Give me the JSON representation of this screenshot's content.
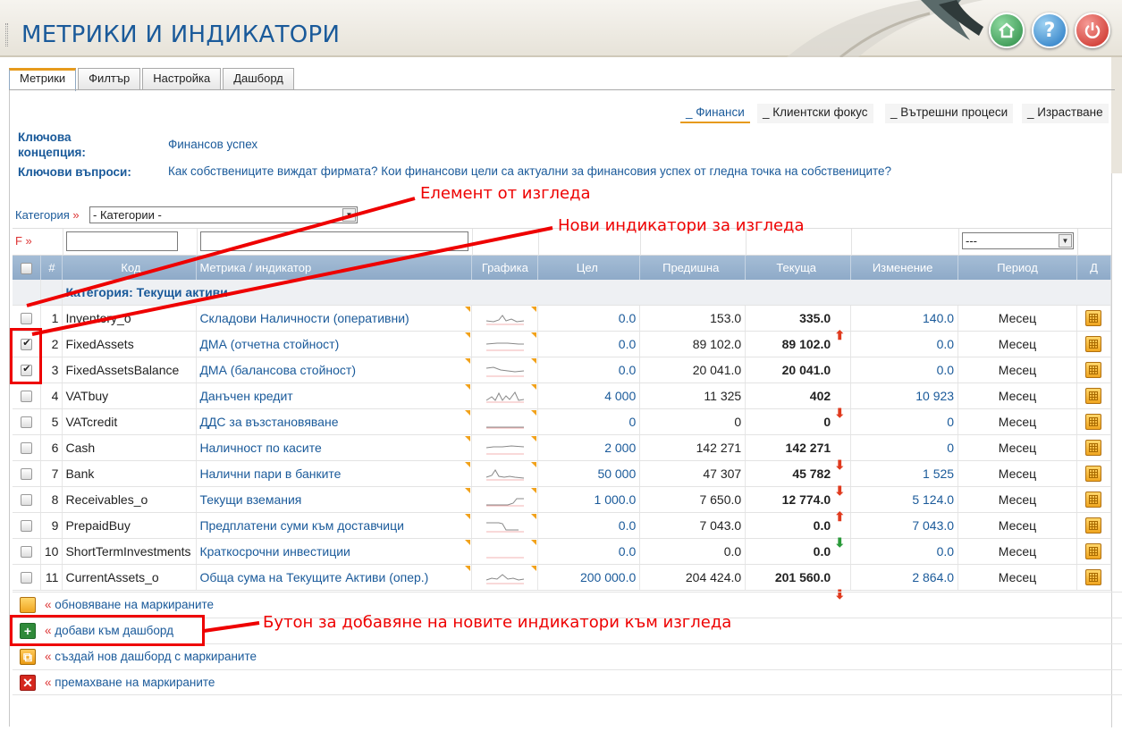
{
  "header": {
    "title": "МЕТРИКИ И ИНДИКАТОРИ",
    "buttons": {
      "home": "home-icon",
      "help": "?",
      "power": "power-icon"
    }
  },
  "tabs": [
    {
      "label": "Метрики",
      "active": true
    },
    {
      "label": "Филтър"
    },
    {
      "label": "Настройка"
    },
    {
      "label": "Дашборд"
    }
  ],
  "perspectives": [
    {
      "label": "_ Финанси",
      "active": true
    },
    {
      "label": "_ Клиентски фокус"
    },
    {
      "label": "_ Вътрешни процеси"
    },
    {
      "label": "_ Израстване"
    }
  ],
  "concept": {
    "label": "Ключова концепция:",
    "value": "Финансов успех",
    "questions_label": "Ключови въпроси:",
    "questions_value": "Как собствениците виждат фирмата? Кои финансови цели са актуални за финансовия успех от гледна точка на собствениците?"
  },
  "filter": {
    "category_label": "Категория",
    "category_marker": "»",
    "category_select": "- Категории -",
    "f_label": "F »",
    "period_select": "---"
  },
  "columns": {
    "num": "#",
    "code": "Код",
    "name": "Метрика / индикатор",
    "graph": "Графика",
    "target": "Цел",
    "previous": "Предишна",
    "current": "Текуща",
    "change": "Изменение",
    "period": "Период",
    "d": "Д"
  },
  "category_row": "Категория: Текущи активи",
  "rows": [
    {
      "n": "1",
      "code": "Inventory_o",
      "name": "Складови Наличности (оперативни)",
      "target": "0.0",
      "prev": "153.0",
      "cur": "335.0",
      "trend": "up",
      "chg": "140.0",
      "per": "Месец",
      "checked": false
    },
    {
      "n": "2",
      "code": "FixedAssets",
      "name": "ДМА (отчетна стойност)",
      "target": "0.0",
      "prev": "89 102.0",
      "cur": "89 102.0",
      "trend": "",
      "chg": "0.0",
      "per": "Месец",
      "checked": true
    },
    {
      "n": "3",
      "code": "FixedAssetsBalance",
      "name": "ДМА (балансова стойност)",
      "target": "0.0",
      "prev": "20 041.0",
      "cur": "20 041.0",
      "trend": "",
      "chg": "0.0",
      "per": "Месец",
      "checked": true
    },
    {
      "n": "4",
      "code": "VATbuy",
      "name": "Данъчен кредит",
      "target": "4 000",
      "prev": "11 325",
      "cur": "402",
      "trend": "down",
      "chg": "10 923",
      "per": "Месец",
      "checked": false
    },
    {
      "n": "5",
      "code": "VATcredit",
      "name": "ДДС за възстановяване",
      "target": "0",
      "prev": "0",
      "cur": "0",
      "trend": "",
      "chg": "0",
      "per": "Месец",
      "checked": false
    },
    {
      "n": "6",
      "code": "Cash",
      "name": "Наличност по касите",
      "target": "2 000",
      "prev": "142 271",
      "cur": "142 271",
      "trend": "down",
      "chg": "0",
      "per": "Месец",
      "checked": false
    },
    {
      "n": "7",
      "code": "Bank",
      "name": "Налични пари в банките",
      "target": "50 000",
      "prev": "47 307",
      "cur": "45 782",
      "trend": "down",
      "chg": "1 525",
      "per": "Месец",
      "checked": false
    },
    {
      "n": "8",
      "code": "Receivables_o",
      "name": "Текущи вземания",
      "target": "1 000.0",
      "prev": "7 650.0",
      "cur": "12 774.0",
      "trend": "up",
      "chg": "5 124.0",
      "per": "Месец",
      "checked": false
    },
    {
      "n": "9",
      "code": "PrepaidBuy",
      "name": "Предплатени суми към доставчици",
      "target": "0.0",
      "prev": "7 043.0",
      "cur": "0.0",
      "trend": "down-green",
      "chg": "7 043.0",
      "per": "Месец",
      "checked": false
    },
    {
      "n": "10",
      "code": "ShortTermInvestments",
      "name": "Краткосрочни инвестиции",
      "target": "0.0",
      "prev": "0.0",
      "cur": "0.0",
      "trend": "",
      "chg": "0.0",
      "per": "Месец",
      "checked": false
    },
    {
      "n": "11",
      "code": "CurrentAssets_o",
      "name": "Обща сума на Текущите Активи (опер.)",
      "target": "200 000.0",
      "prev": "204 424.0",
      "cur": "201 560.0",
      "trend": "down",
      "chg": "2 864.0",
      "per": "Месец",
      "checked": false
    }
  ],
  "actions": [
    {
      "marker": "«",
      "label": "обновяване на маркираните",
      "icon": "calculator-icon"
    },
    {
      "marker": "«",
      "label": "добави към дашборд",
      "icon": "plus-icon"
    },
    {
      "marker": "«",
      "label": "създай нов дашборд с маркираните",
      "icon": "new-dashboard-icon"
    },
    {
      "marker": "«",
      "label": "премахване на маркираните",
      "icon": "delete-icon"
    }
  ],
  "annotations": {
    "element": "Елемент от изгледа",
    "new_indicators": "Нови индикатори за изгледа",
    "add_button": "Бутон за добавяне на новите индикатори към изгледа"
  },
  "colors": {
    "accent": "#1a5a9a",
    "header_bg": "#8eaac8",
    "annotation": "#e00000",
    "tab_active": "#e69a1c"
  }
}
